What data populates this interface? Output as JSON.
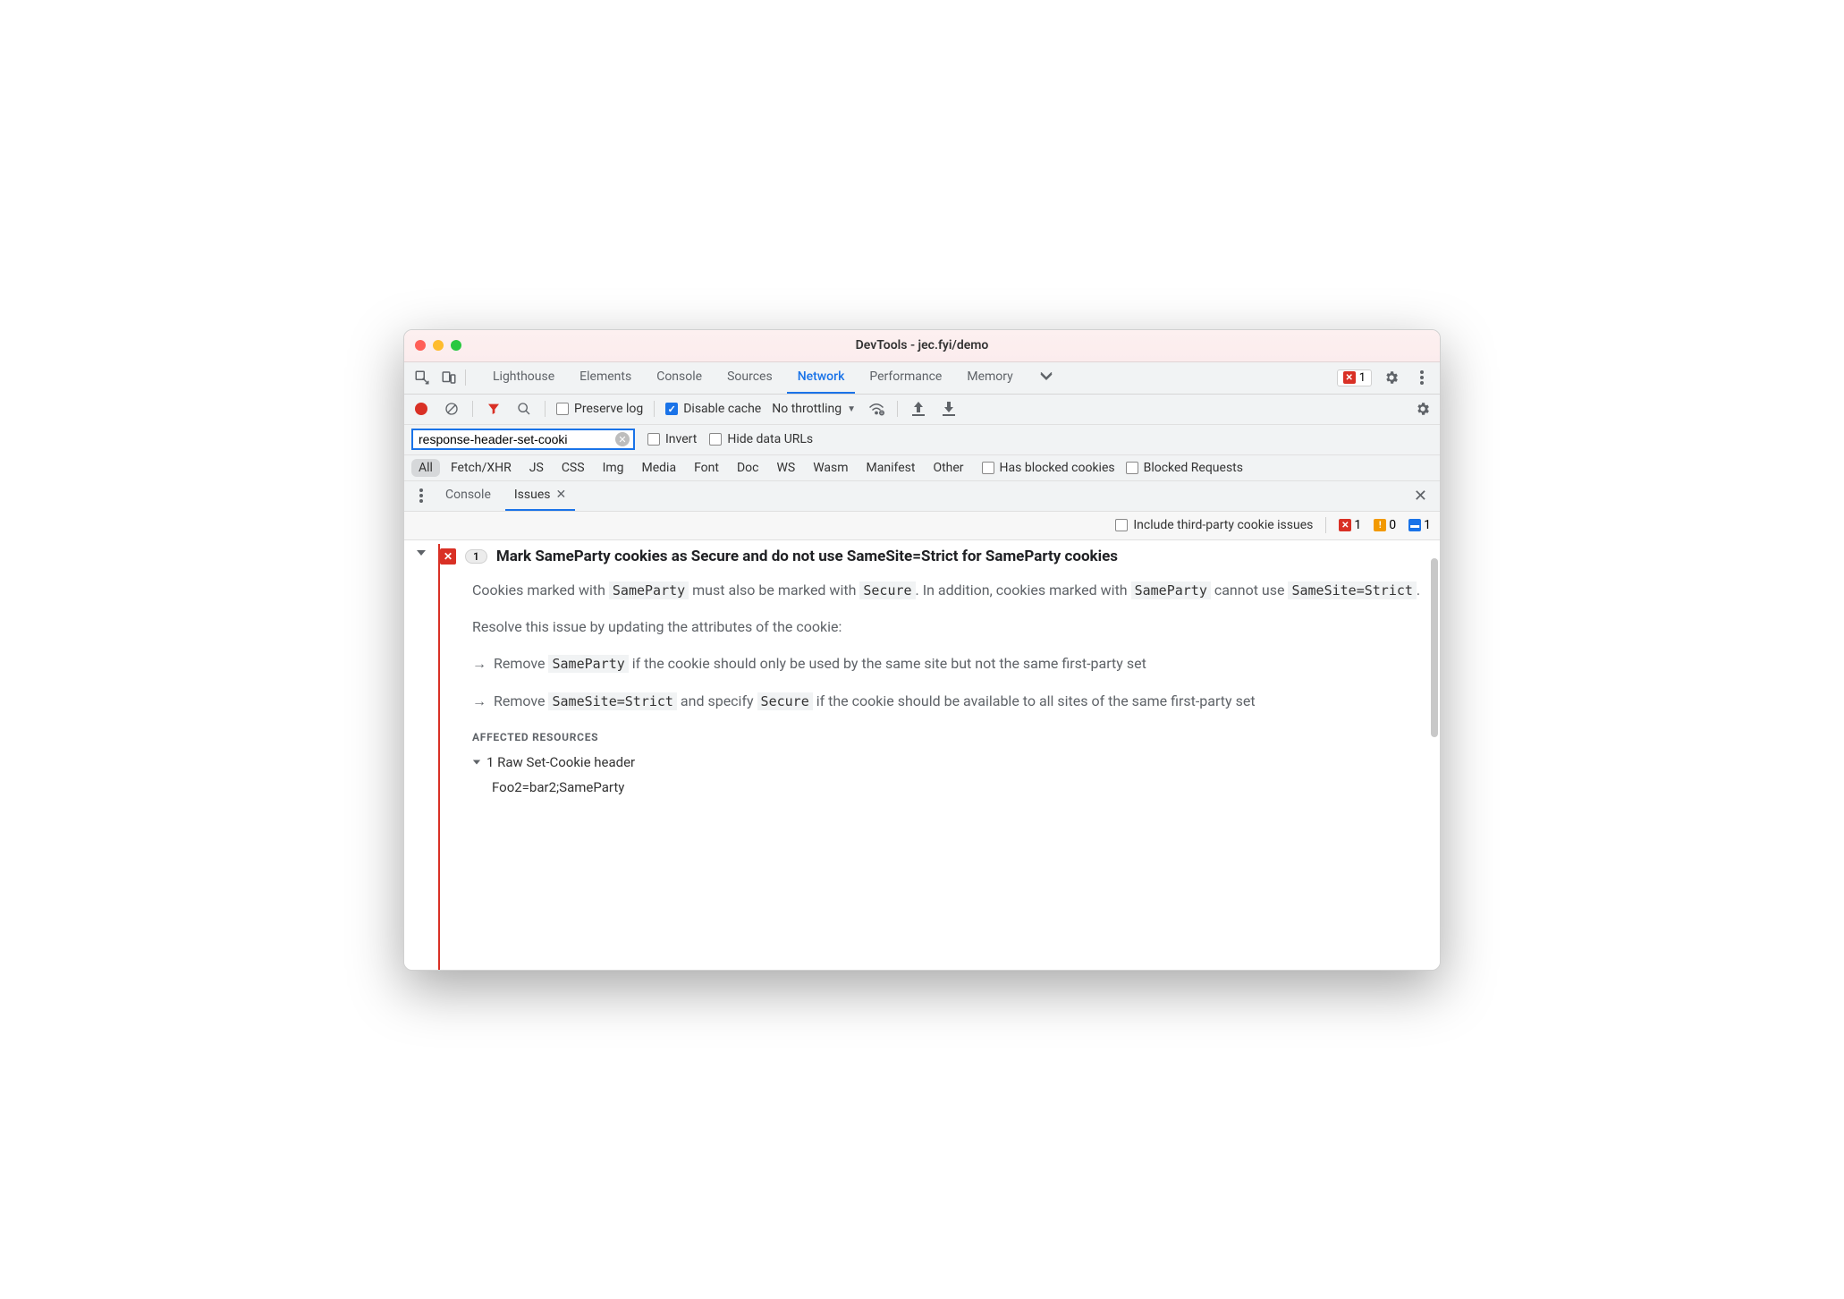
{
  "window": {
    "title": "DevTools - jec.fyi/demo"
  },
  "mainTabs": {
    "items": [
      "Lighthouse",
      "Elements",
      "Console",
      "Sources",
      "Network",
      "Performance",
      "Memory"
    ],
    "active": "Network"
  },
  "toolbarRight": {
    "errorCount": "1"
  },
  "networkBar": {
    "preserveLog": {
      "label": "Preserve log",
      "checked": false
    },
    "disableCache": {
      "label": "Disable cache",
      "checked": true
    },
    "throttling": "No throttling"
  },
  "filterBar": {
    "filterValue": "response-header-set-cooki",
    "invert": {
      "label": "Invert",
      "checked": false
    },
    "hideDataUrls": {
      "label": "Hide data URLs",
      "checked": false
    }
  },
  "typeBar": {
    "types": [
      "All",
      "Fetch/XHR",
      "JS",
      "CSS",
      "Img",
      "Media",
      "Font",
      "Doc",
      "WS",
      "Wasm",
      "Manifest",
      "Other"
    ],
    "active": "All",
    "hasBlockedCookies": {
      "label": "Has blocked cookies",
      "checked": false
    },
    "blockedRequests": {
      "label": "Blocked Requests",
      "checked": false
    }
  },
  "drawer": {
    "tabs": [
      "Console",
      "Issues"
    ],
    "active": "Issues"
  },
  "issuesToolbar": {
    "includeThirdParty": {
      "label": "Include third-party cookie issues",
      "checked": false
    },
    "counts": {
      "error": "1",
      "warning": "0",
      "info": "1"
    }
  },
  "issue": {
    "count": "1",
    "title": "Mark SameParty cookies as Secure and do not use SameSite=Strict for SameParty cookies",
    "desc": {
      "p1_a": "Cookies marked with ",
      "p1_code1": "SameParty",
      "p1_b": " must also be marked with ",
      "p1_code2": "Secure",
      "p1_c": ". In addition, cookies marked with ",
      "p1_code3": "SameParty",
      "p1_d": " cannot use ",
      "p1_code4": "SameSite=Strict",
      "p1_e": ".",
      "p2": "Resolve this issue by updating the attributes of the cookie:",
      "b1_a": "Remove ",
      "b1_code": "SameParty",
      "b1_b": " if the cookie should only be used by the same site but not the same first-party set",
      "b2_a": "Remove ",
      "b2_code1": "SameSite=Strict",
      "b2_b": " and specify ",
      "b2_code2": "Secure",
      "b2_c": " if the cookie should be available to all sites of the same first-party set"
    },
    "affectedHeading": "AFFECTED RESOURCES",
    "resourceSummary": "1 Raw Set-Cookie header",
    "resourceDetail": "Foo2=bar2;SameParty"
  }
}
